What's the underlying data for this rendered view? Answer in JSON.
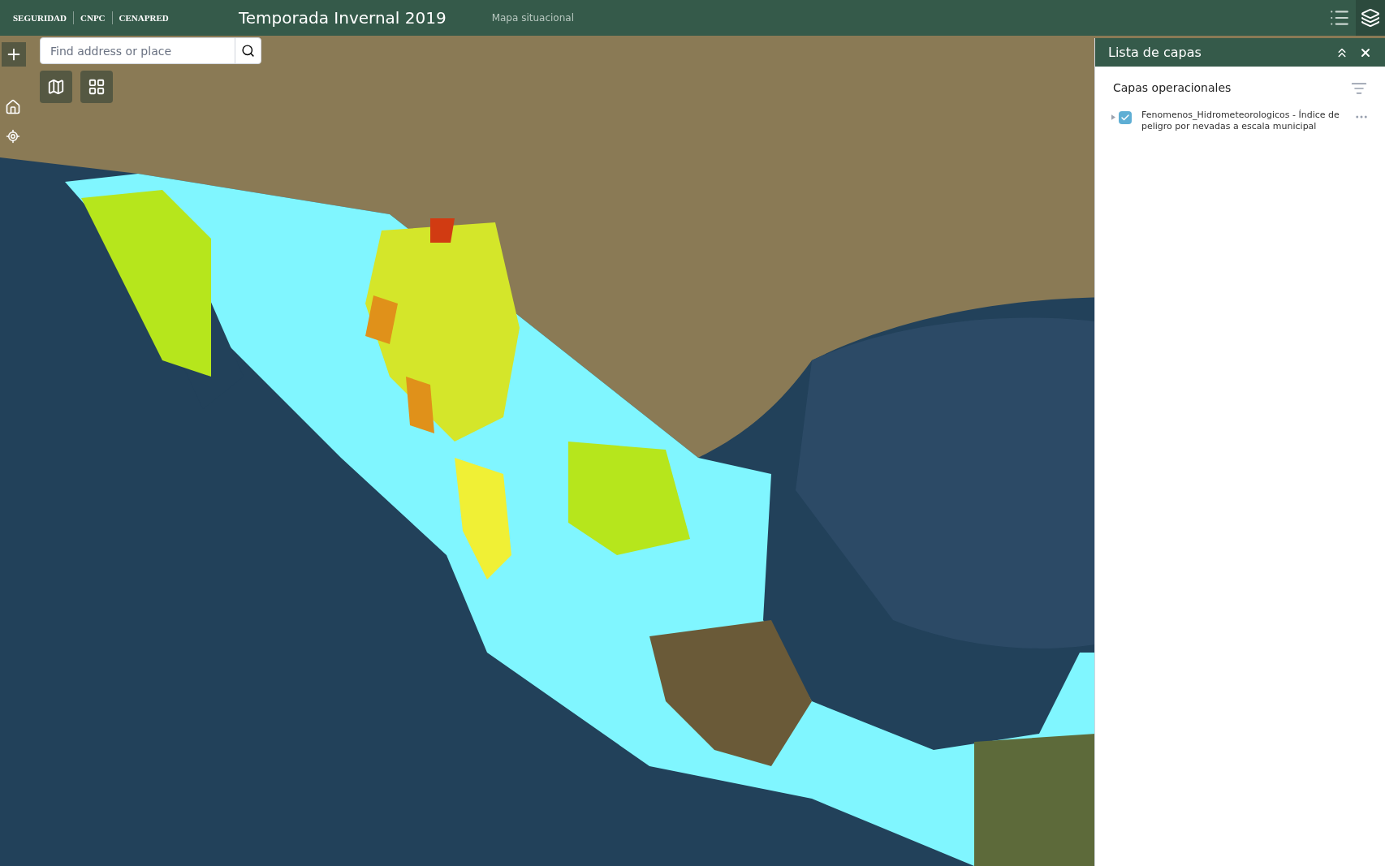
{
  "header": {
    "logos": [
      "SEGURIDAD",
      "CNPC",
      "CENAPRED"
    ],
    "title": "Temporada Invernal 2019",
    "subtitle": "Mapa situacional"
  },
  "search": {
    "placeholder": "Find address or place"
  },
  "layer_panel": {
    "title": "Lista de capas",
    "section": "Capas operacionales",
    "layers": [
      {
        "name": "Fenomenos_Hidrometeorologicos - Índice de peligro por nevadas a escala municipal",
        "checked": true,
        "expanded": false
      }
    ]
  }
}
